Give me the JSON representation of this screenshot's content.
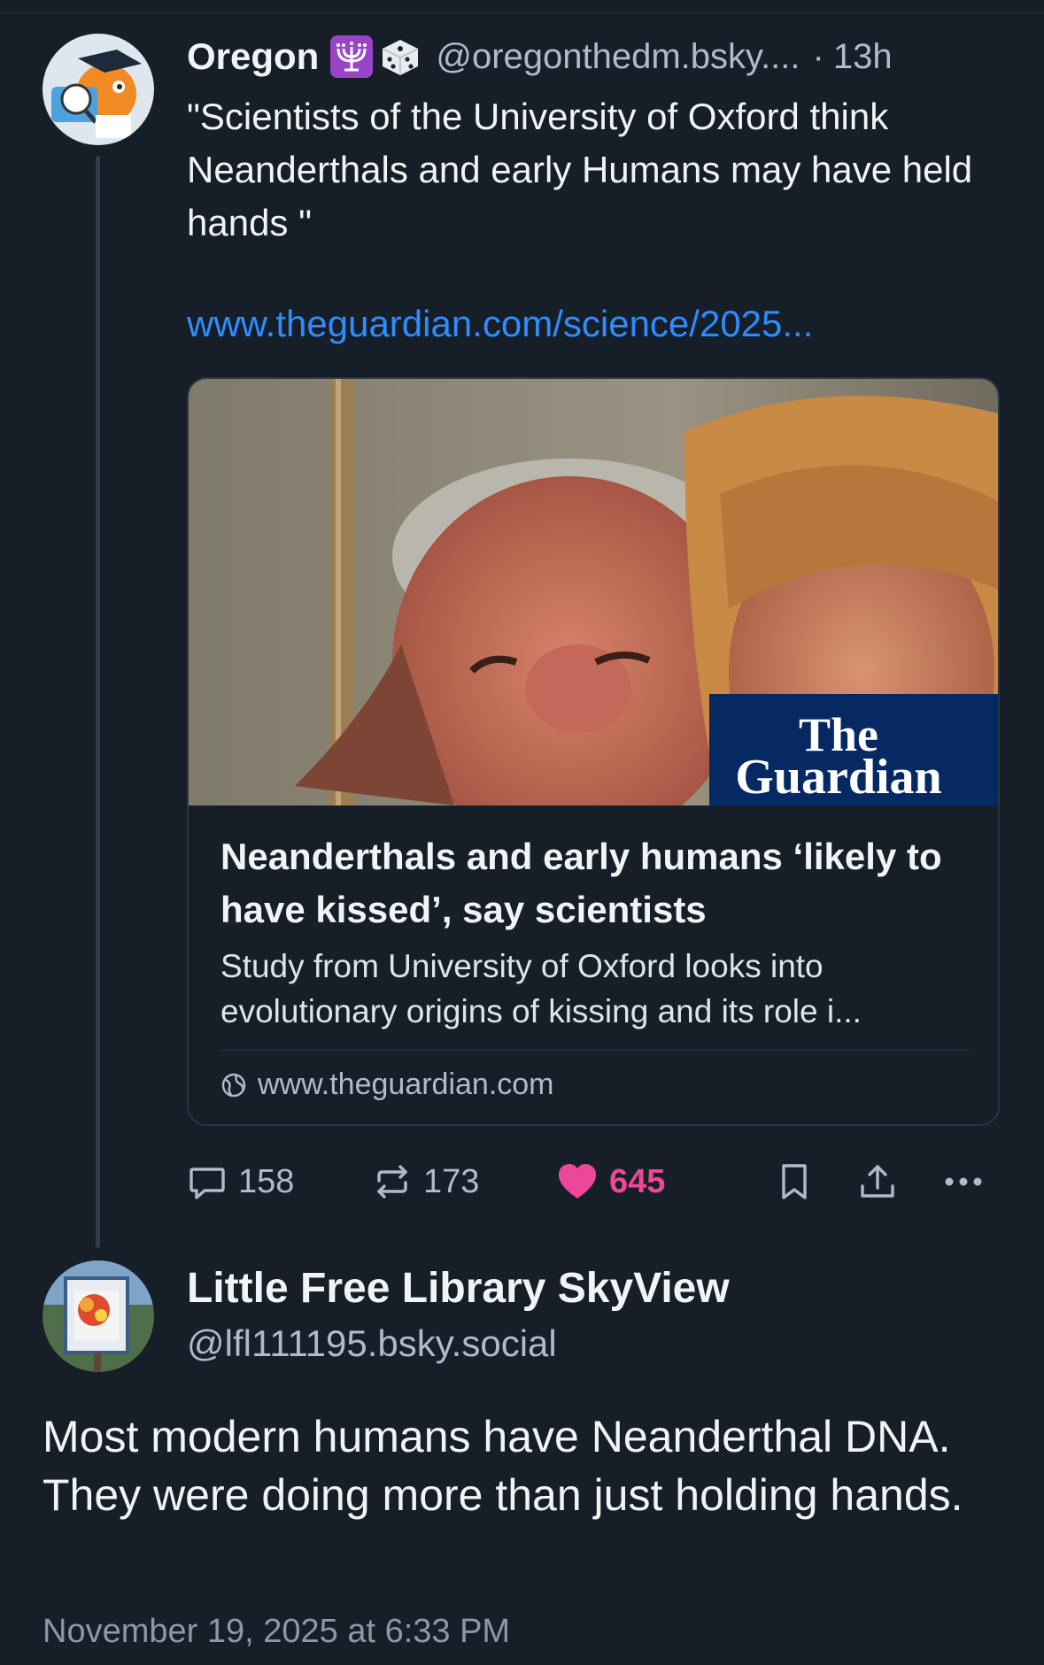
{
  "post": {
    "author": {
      "display_name": "Oregon",
      "emoji": [
        "menorah-emoji",
        "dice-emoji"
      ],
      "handle": "@oregonthedm.bsky....",
      "separator": "·",
      "time_ago": "13h"
    },
    "text": "\"Scientists of the University of Oxford think Neanderthals and early Humans may have held hands \"",
    "link": "www.theguardian.com/science/2025...",
    "embed": {
      "logo_line1": "The",
      "logo_line2": "Guardian",
      "title": "Neanderthals and early humans ‘likely to have kissed’, say scientists",
      "description": "Study from University of Oxford looks into evolutionary origins of kissing and its role i...",
      "domain": "www.theguardian.com"
    },
    "actions": {
      "replies": "158",
      "reposts": "173",
      "likes": "645"
    }
  },
  "reply": {
    "author": {
      "display_name": "Little Free Library SkyView",
      "handle": "@lfl111195.bsky.social"
    },
    "text": "Most modern humans have Neanderthal DNA. They were doing more than just holding hands.",
    "timestamp": "November 19, 2025 at 6:33 PM"
  },
  "colors": {
    "background": "#161e27",
    "link": "#2e8cff",
    "like": "#ec4899",
    "muted": "#aebbc9",
    "guardian_blue": "#052962"
  },
  "icons": [
    "reply-icon",
    "repost-icon",
    "heart-icon",
    "bookmark-icon",
    "share-icon",
    "more-icon",
    "globe-icon"
  ]
}
